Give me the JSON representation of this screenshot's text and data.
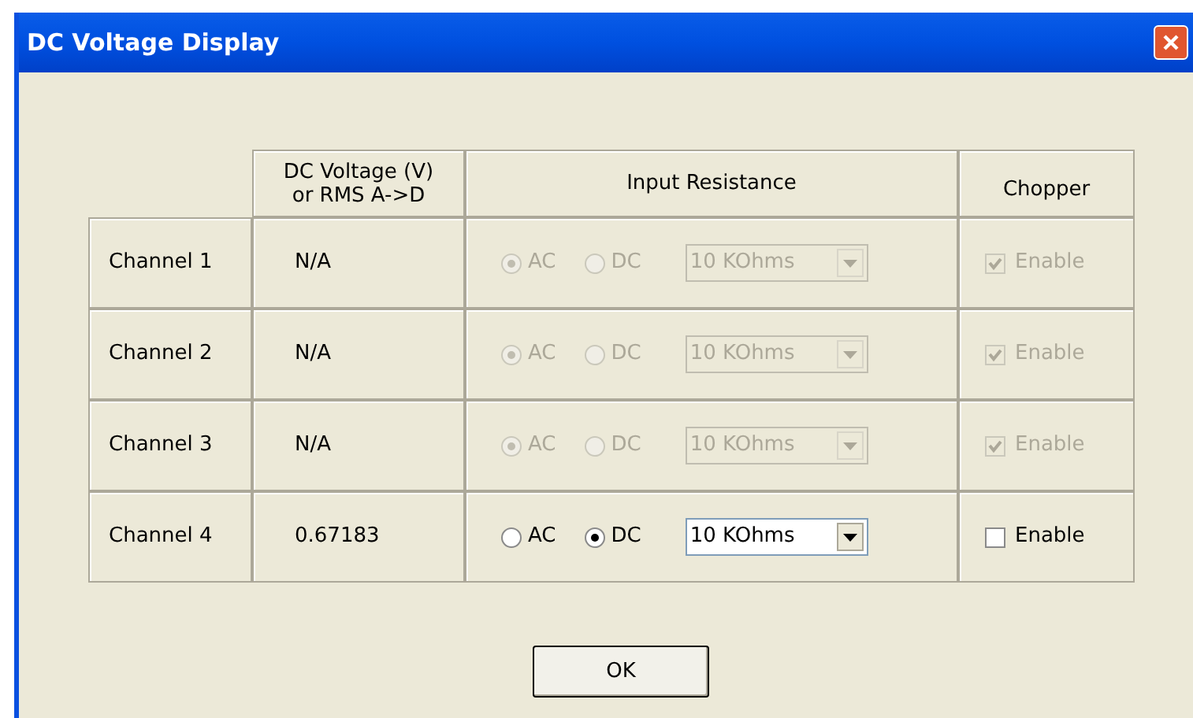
{
  "window": {
    "title": "DC Voltage Display"
  },
  "columns": [
    "DC Voltage (V)\nor RMS A->D",
    "Input Resistance",
    "Chopper"
  ],
  "rows": [
    {
      "label": "Channel 1",
      "value": "N/A",
      "disabled": true,
      "coupling": [
        {
          "label": "AC",
          "selected": true
        },
        {
          "label": "DC",
          "selected": false
        }
      ],
      "resistance": "10 KOhms",
      "chopper": {
        "label": "Enable",
        "checked": true
      }
    },
    {
      "label": "Channel 2",
      "value": "N/A",
      "disabled": true,
      "coupling": [
        {
          "label": "AC",
          "selected": true
        },
        {
          "label": "DC",
          "selected": false
        }
      ],
      "resistance": "10 KOhms",
      "chopper": {
        "label": "Enable",
        "checked": true
      }
    },
    {
      "label": "Channel 3",
      "value": "N/A",
      "disabled": true,
      "coupling": [
        {
          "label": "AC",
          "selected": true
        },
        {
          "label": "DC",
          "selected": false
        }
      ],
      "resistance": "10 KOhms",
      "chopper": {
        "label": "Enable",
        "checked": true
      }
    },
    {
      "label": "Channel 4",
      "value": "0.67183",
      "disabled": false,
      "coupling": [
        {
          "label": "AC",
          "selected": false
        },
        {
          "label": "DC",
          "selected": true
        }
      ],
      "resistance": "10 KOhms",
      "chopper": {
        "label": "Enable",
        "checked": false
      }
    }
  ],
  "buttons": [
    "OK"
  ]
}
